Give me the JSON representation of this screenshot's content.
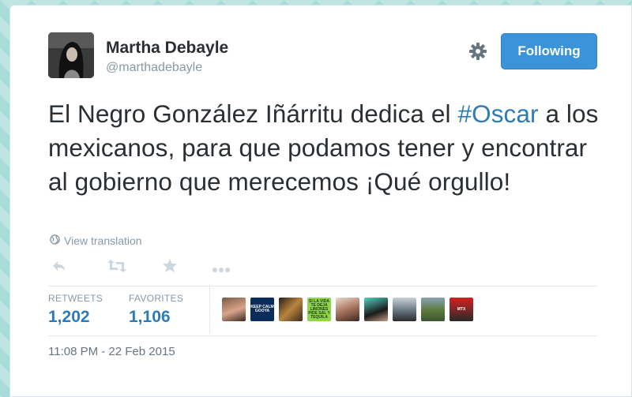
{
  "tweet": {
    "author_name": "Martha Debayle",
    "author_handle": "@marthadebayle",
    "follow_label": "Following",
    "text_before": "El Negro González Iñárritu dedica el ",
    "hashtag": "#Oscar",
    "text_after": " a los mexicanos, para que podamos tener y encontrar al gobierno que merecemos ¡Qué orgullo!",
    "translate_label": "View translation",
    "timestamp": "11:08 PM - 22 Feb 2015"
  },
  "stats": {
    "retweets_label": "RETWEETS",
    "retweets_value": "1,202",
    "favorites_label": "FAVORITES",
    "favorites_value": "1,106"
  },
  "favoriters": [
    {
      "kind": "photo",
      "text": ""
    },
    {
      "kind": "keep-calm",
      "text": "KEEP CALM GOOYA"
    },
    {
      "kind": "photo",
      "text": ""
    },
    {
      "kind": "sign",
      "text": "SI LA VIDA TE DEJA LIMONES PIDE SAL Y TEQUILA"
    },
    {
      "kind": "photo",
      "text": ""
    },
    {
      "kind": "photo",
      "text": ""
    },
    {
      "kind": "photo",
      "text": ""
    },
    {
      "kind": "photo",
      "text": ""
    },
    {
      "kind": "logo",
      "text": "MTX"
    }
  ],
  "icons": {
    "gear": "gear-icon",
    "globe": "globe-icon",
    "reply": "reply-icon",
    "retweet": "retweet-icon",
    "favorite": "star-icon",
    "more": "more-icon"
  },
  "colors": {
    "accent": "#3b94d9",
    "link": "#2b7bb9",
    "text": "#292f33",
    "muted": "#8899a6",
    "background": "#a9dcd8"
  }
}
